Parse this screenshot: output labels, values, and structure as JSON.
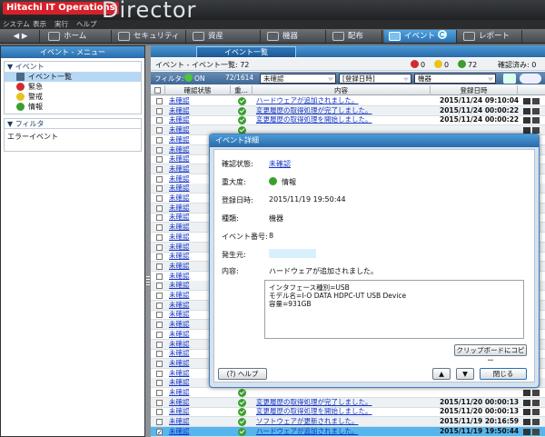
{
  "app": {
    "logo": "Hitachi IT Operations",
    "product": "Director"
  },
  "menu": [
    "システム",
    "表示",
    "実行",
    "ヘルプ"
  ],
  "nav": [
    {
      "label": "ホーム",
      "icon": "home-icon"
    },
    {
      "label": "セキュリティ",
      "icon": "shield-icon"
    },
    {
      "label": "資産",
      "icon": "box-icon"
    },
    {
      "label": "機器",
      "icon": "device-icon"
    },
    {
      "label": "配布",
      "icon": "distribute-icon"
    },
    {
      "label": "イベント",
      "icon": "event-icon",
      "active": true
    },
    {
      "label": "レポート",
      "icon": "report-icon"
    }
  ],
  "left": {
    "header": "イベント - メニュー",
    "event_group": "▼ イベント",
    "items": [
      {
        "label": "イベント一覧",
        "icon": "event-list-icon",
        "color": "#ffffff"
      },
      {
        "label": "緊急",
        "icon": "critical-icon",
        "color": "#d22b2b"
      },
      {
        "label": "警戒",
        "icon": "warning-icon",
        "color": "#e9c21a"
      },
      {
        "label": "情報",
        "icon": "info-icon",
        "color": "#3a9f2e"
      }
    ],
    "filter_group": "▼ フィルタ",
    "filter_items": [
      "エラーイベント"
    ]
  },
  "right": {
    "tab": "イベント一覧",
    "summary_title": "イベント - イベント一覧: 72",
    "counts": {
      "critical": "0",
      "warning": "0",
      "info": "72"
    },
    "confirmed": "確認済み: 0",
    "filter": {
      "label": "フィルタ:",
      "state": "ON",
      "count": "72/1614",
      "sel1": "未確認",
      "sel2": "[登録日時]",
      "sel3": "機器"
    },
    "columns": [
      "確認状態",
      "重...",
      "内容",
      "登録日時"
    ],
    "rows": [
      {
        "status": "未確認",
        "msg": "ハードウェアが追加されました。",
        "date": "2015/11/24 09:10:04"
      },
      {
        "status": "未確認",
        "msg": "変更履歴の取得処理が完了しました。",
        "date": "2015/11/24 00:00:22"
      },
      {
        "status": "未確認",
        "msg": "変更履歴の取得処理を開始しました。",
        "date": "2015/11/24 00:00:22"
      },
      {
        "status": "未確認",
        "msg": "",
        "date": ""
      },
      {
        "status": "未確認",
        "msg": "",
        "date": ""
      },
      {
        "status": "未確認",
        "msg": "",
        "date": ""
      },
      {
        "status": "未確認",
        "msg": "",
        "date": ""
      },
      {
        "status": "未確認",
        "msg": "",
        "date": ""
      },
      {
        "status": "未確認",
        "msg": "",
        "date": ""
      },
      {
        "status": "未確認",
        "msg": "",
        "date": ""
      },
      {
        "status": "未確認",
        "msg": "",
        "date": ""
      },
      {
        "status": "未確認",
        "msg": "",
        "date": ""
      },
      {
        "status": "未確認",
        "msg": "",
        "date": ""
      },
      {
        "status": "未確認",
        "msg": "",
        "date": ""
      },
      {
        "status": "未確認",
        "msg": "",
        "date": ""
      },
      {
        "status": "未確認",
        "msg": "",
        "date": ""
      },
      {
        "status": "未確認",
        "msg": "",
        "date": ""
      },
      {
        "status": "未確認",
        "msg": "",
        "date": ""
      },
      {
        "status": "未確認",
        "msg": "",
        "date": ""
      },
      {
        "status": "未確認",
        "msg": "",
        "date": ""
      },
      {
        "status": "未確認",
        "msg": "",
        "date": ""
      },
      {
        "status": "未確認",
        "msg": "",
        "date": ""
      },
      {
        "status": "未確認",
        "msg": "",
        "date": ""
      },
      {
        "status": "未確認",
        "msg": "",
        "date": ""
      },
      {
        "status": "未確認",
        "msg": "",
        "date": ""
      },
      {
        "status": "未確認",
        "msg": "",
        "date": ""
      },
      {
        "status": "未確認",
        "msg": "",
        "date": ""
      },
      {
        "status": "未確認",
        "msg": "",
        "date": ""
      },
      {
        "status": "未確認",
        "msg": "",
        "date": ""
      },
      {
        "status": "未確認",
        "msg": "",
        "date": ""
      },
      {
        "status": "未確認",
        "msg": "",
        "date": ""
      },
      {
        "status": "未確認",
        "msg": "変更履歴の取得処理が完了しました。",
        "date": "2015/11/20 00:00:13"
      },
      {
        "status": "未確認",
        "msg": "変更履歴の取得処理を開始しました。",
        "date": "2015/11/20 00:00:13"
      },
      {
        "status": "未確認",
        "msg": "ソフトウェアが更新されました。",
        "date": "2015/11/19 20:16:59"
      },
      {
        "status": "未確認",
        "msg": "ハードウェアが追加されました。",
        "date": "2015/11/19 19:50:44",
        "selected": true
      }
    ]
  },
  "dialog": {
    "title": "イベント詳細",
    "status_label": "確認状態:",
    "status_value": "未確認",
    "severity_label": "重大度:",
    "severity_value": "情報",
    "date_label": "登録日時:",
    "date_value": "2015/11/19 19:50:44",
    "kind_label": "種類:",
    "kind_value": "機器",
    "number_label": "イベント番号:",
    "number_value": "8",
    "source_label": "発生元:",
    "content_label": "内容:",
    "content_value": "ハードウェアが追加されました。",
    "detail_lines": [
      "インタフェース種別=USB",
      "モデル名=I-O DATA HDPC-UT USB Device",
      "容量=931GB"
    ],
    "copy_button": "クリップボードにコピー",
    "help_button": "ヘルプ",
    "close_button": "閉じる"
  }
}
